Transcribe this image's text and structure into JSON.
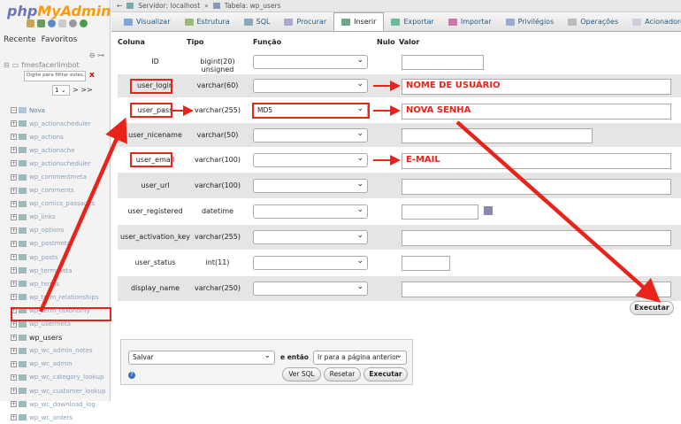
{
  "sidebar": {
    "logo_php": "php",
    "logo_myadmin": "MyAdmin",
    "tab_recent": "Recente",
    "tab_favorites": "Favoritos",
    "db_name": "fmesfacerlimbot",
    "filter_placeholder": "Digite para filtrar estes, E",
    "filter_clear": "x",
    "page_value": "1",
    "page_next": "> >>",
    "tree_new": "Nova",
    "tree_items": [
      "wp_actionscheduler",
      "wp_actions",
      "wp_actionsche",
      "wp_actionscheduler",
      "wp_commentmeta",
      "wp_comments",
      "wp_comics_passades",
      "wp_links",
      "wp_options",
      "wp_postmeta",
      "wp_posts",
      "wp_termmeta",
      "wp_terms",
      "wp_term_relationships",
      "wp_term_taxonomy",
      "wp_usermeta",
      "wp_users",
      "wp_wc_admin_notes",
      "wp_wc_admin",
      "wp_wc_category_lookup",
      "wp_wc_customer_lookup",
      "wp_wc_download_log",
      "wp_wc_orders"
    ],
    "active_index": 16
  },
  "topbar": {
    "server": "Servidor: localhost",
    "table": "Tabela: wp_users"
  },
  "tabs": [
    {
      "label": "Visualizar",
      "color": "#7aa7d6"
    },
    {
      "label": "Estrutura",
      "color": "#9b7"
    },
    {
      "label": "SQL",
      "color": "#8ab"
    },
    {
      "label": "Procurar",
      "color": "#aac"
    },
    {
      "label": "Inserir",
      "color": "#6a8"
    },
    {
      "label": "Exportar",
      "color": "#6b9"
    },
    {
      "label": "Importar",
      "color": "#c7a"
    },
    {
      "label": "Privilégios",
      "color": "#9ac"
    },
    {
      "label": "Operações",
      "color": "#bbb"
    },
    {
      "label": "Acionadores",
      "color": "#ccd"
    }
  ],
  "active_tab": 4,
  "columns": {
    "name": "Coluna",
    "type": "Tipo",
    "function": "Função",
    "null": "Nulo",
    "value": "Valor"
  },
  "rows": [
    {
      "name": "ID",
      "type": "bigint(20) unsigned",
      "func": "",
      "value": ""
    },
    {
      "name": "user_login",
      "type": "varchar(60)",
      "func": "",
      "value": "NOME DE USUÁRIO"
    },
    {
      "name": "user_pass",
      "type": "varchar(255)",
      "func": "MD5",
      "value": "NOVA SENHA"
    },
    {
      "name": "user_nicename",
      "type": "varchar(50)",
      "func": "",
      "value": ""
    },
    {
      "name": "user_email",
      "type": "varchar(100)",
      "func": "",
      "value": "E-MAIL"
    },
    {
      "name": "user_url",
      "type": "varchar(100)",
      "func": "",
      "value": ""
    },
    {
      "name": "user_registered",
      "type": "datetime",
      "func": "",
      "value": ""
    },
    {
      "name": "user_activation_key",
      "type": "varchar(255)",
      "func": "",
      "value": ""
    },
    {
      "name": "user_status",
      "type": "int(11)",
      "func": "",
      "value": ""
    },
    {
      "name": "display_name",
      "type": "varchar(250)",
      "func": "",
      "value": ""
    }
  ],
  "execute_label": "Executar",
  "bottom": {
    "action": "Salvar",
    "then_label": "e então",
    "then_option": "Ir para a página anterior",
    "view_sql": "Ver SQL",
    "reset": "Resetar",
    "execute": "Executar"
  },
  "colors": {
    "annotation": "#e8231a",
    "link": "#235a81",
    "row_alt": "#e5e5e5"
  }
}
